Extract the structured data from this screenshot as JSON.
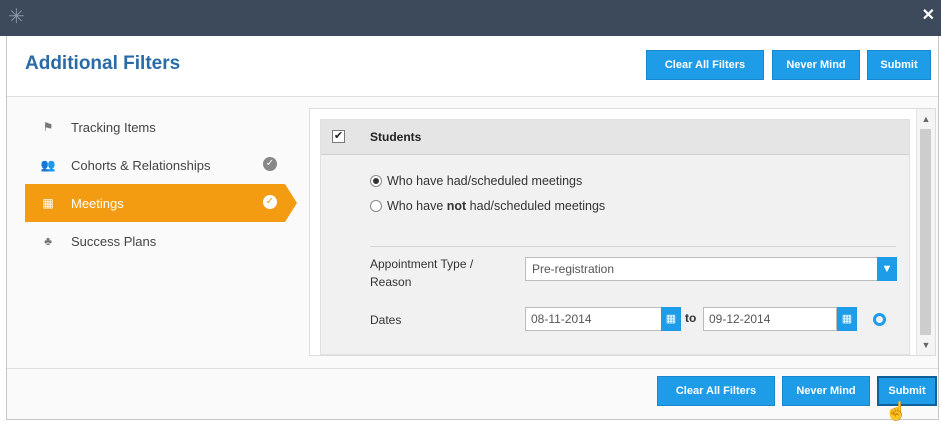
{
  "window": {
    "close_symbol": "✕"
  },
  "header": {
    "title": "Additional Filters"
  },
  "buttons": {
    "clear": "Clear All Filters",
    "never_mind": "Never Mind",
    "submit": "Submit"
  },
  "sidebar": {
    "items": [
      {
        "label": "Tracking Items",
        "icon": "flag-icon",
        "checked": false
      },
      {
        "label": "Cohorts & Relationships",
        "icon": "people-icon",
        "checked": true
      },
      {
        "label": "Meetings",
        "icon": "calendar-icon",
        "checked": true,
        "active": true
      },
      {
        "label": "Success Plans",
        "icon": "hierarchy-icon",
        "checked": false
      }
    ]
  },
  "students": {
    "label": "Students",
    "checked": true,
    "option_had": "Who have had/scheduled meetings",
    "option_not_pre": "Who have ",
    "option_not_bold": "not",
    "option_not_post": " had/scheduled meetings",
    "selected_option": "had"
  },
  "appointment": {
    "label_line1": "Appointment Type /",
    "label_line2": "Reason",
    "value": "Pre-registration"
  },
  "dates": {
    "label": "Dates",
    "from": "08-11-2014",
    "to_word": "to",
    "to": "09-12-2014"
  },
  "colors": {
    "accent": "#1e9ce8",
    "active": "#f39c12",
    "title": "#2a6aa6",
    "titlebar": "#3d4a5c"
  }
}
